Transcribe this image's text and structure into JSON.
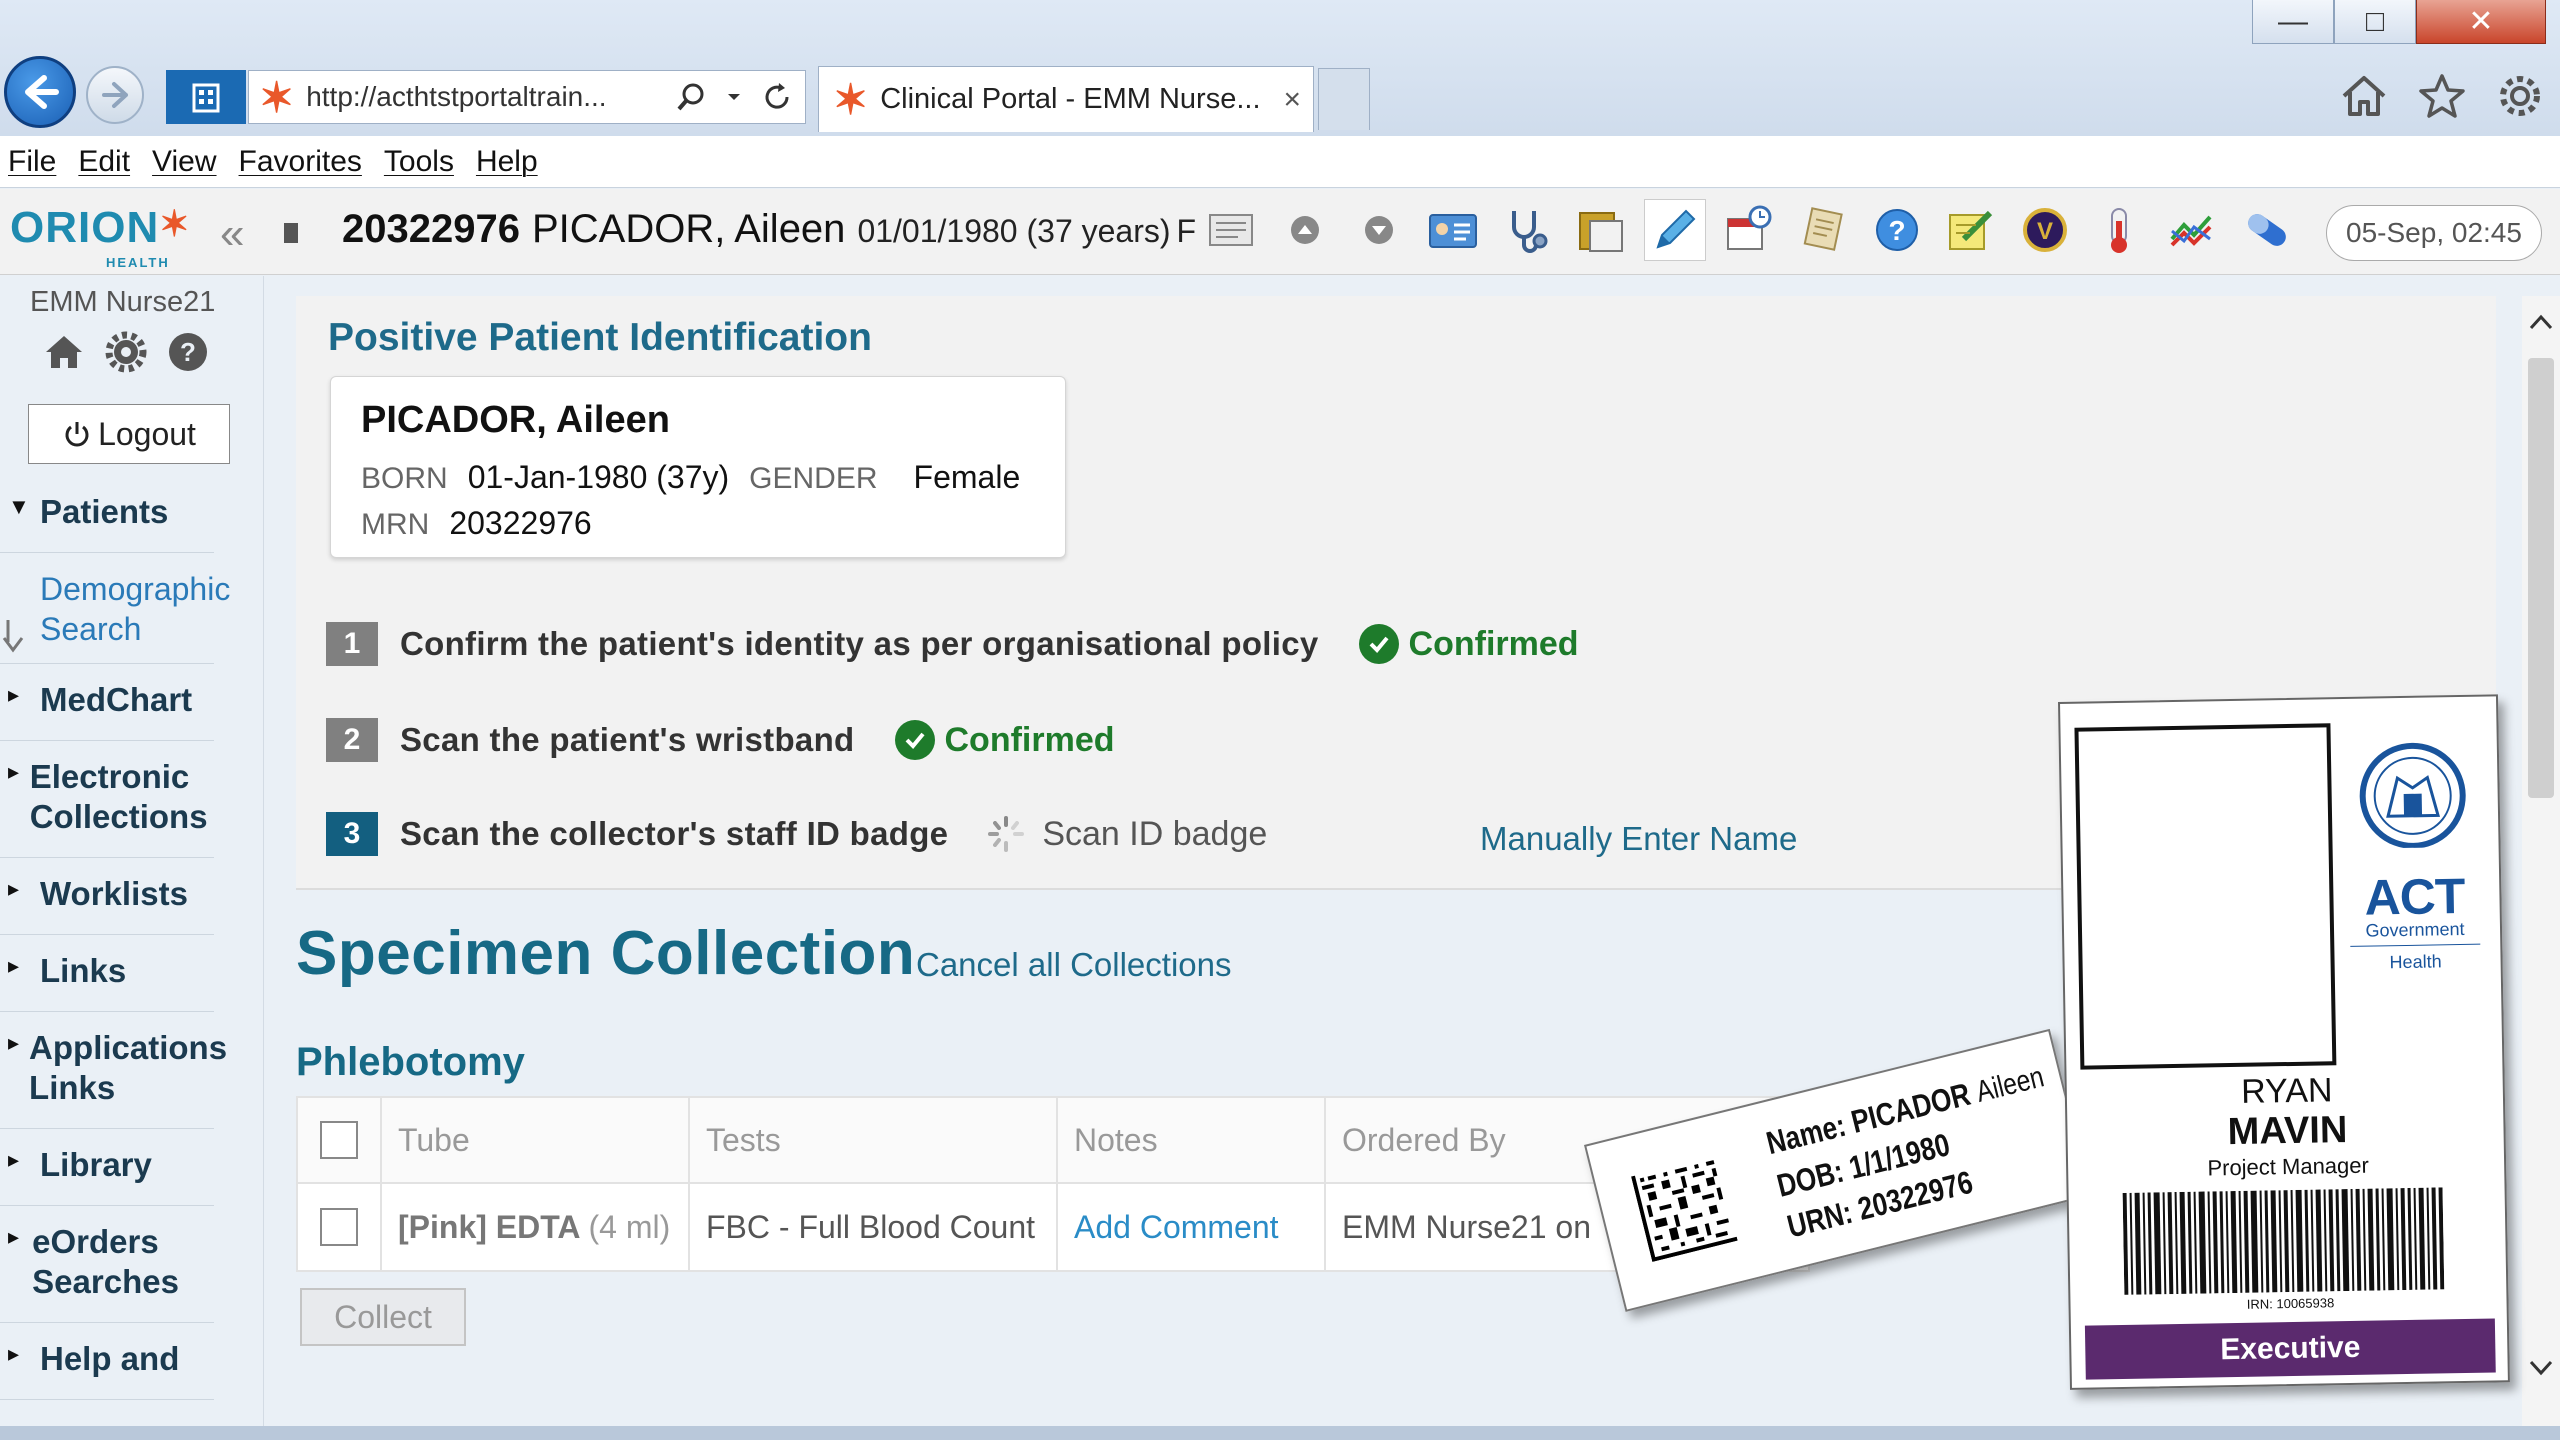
{
  "window": {
    "minimize": "—",
    "maximize": "□",
    "close": "✕"
  },
  "browser": {
    "address": "http://acthtstportaltrain...",
    "tab_title": "Clinical Portal - EMM Nurse...",
    "tab_close": "×",
    "menu": [
      "File",
      "Edit",
      "View",
      "Favorites",
      "Tools",
      "Help"
    ]
  },
  "header": {
    "logo": "ORION",
    "logo_sub": "HEALTH",
    "collapse": "«",
    "patient_mrn": "20322976",
    "patient_name": "PICADOR, Aileen",
    "patient_dob": "01/01/1980 (37 years)",
    "patient_sex": "F",
    "date": "05-Sep, 02:45",
    "toolbar_icons": [
      "notes-icon",
      "up-icon",
      "down-icon",
      "id-card-icon",
      "stethoscope-icon",
      "folder-icon",
      "pen-icon",
      "calendar-icon",
      "scroll-icon",
      "help-icon",
      "edit-icon",
      "badge-icon",
      "thermometer-icon",
      "chart-icon",
      "pill-icon"
    ]
  },
  "sidebar": {
    "user": "EMM Nurse21",
    "logout": "Logout",
    "nav": [
      {
        "label": "Patients",
        "expanded": true
      },
      {
        "label": "Demographic Search",
        "sub": true
      },
      {
        "label": "MedChart"
      },
      {
        "label": "Electronic Collections"
      },
      {
        "label": "Worklists"
      },
      {
        "label": "Links"
      },
      {
        "label": "Applications Links"
      },
      {
        "label": "Library"
      },
      {
        "label": "eOrders Searches"
      },
      {
        "label": "Help and"
      }
    ]
  },
  "ppi": {
    "title": "Positive Patient Identification",
    "card": {
      "name": "PICADOR, Aileen",
      "born_label": "BORN",
      "born": "01-Jan-1980 (37y)",
      "gender_label": "GENDER",
      "gender": "Female",
      "mrn_label": "MRN",
      "mrn": "20322976"
    },
    "steps": [
      {
        "num": "1",
        "text": "Confirm the patient's identity as per organisational policy",
        "status": "Confirmed"
      },
      {
        "num": "2",
        "text": "Scan the patient's wristband",
        "status": "Confirmed"
      },
      {
        "num": "3",
        "text": "Scan the collector's staff ID badge",
        "status": "Scan ID badge"
      }
    ],
    "manual_link": "Manually Enter Name"
  },
  "specimen": {
    "title": "Specimen Collection",
    "cancel_link": "Cancel all Collections",
    "section": "Phlebotomy",
    "columns": [
      "Tube",
      "Tests",
      "Notes",
      "Ordered By"
    ],
    "rows": [
      {
        "tube": "[Pink] EDTA",
        "volume": "(4 ml)",
        "tests": "FBC - Full Blood Count",
        "notes": "Add Comment",
        "ordered_by": "EMM Nurse21 on"
      }
    ],
    "collect_button": "Collect"
  },
  "wristband": {
    "name_label": "Name:",
    "surname": "PICADOR",
    "given": "Aileen",
    "dob_label": "DOB:",
    "dob": "1/1/1980",
    "urn_label": "URN:",
    "urn": "20322976"
  },
  "badge": {
    "org": "ACT",
    "org_sub": "Government",
    "dept": "Health",
    "first_name": "RYAN",
    "last_name": "MAVIN",
    "role": "Project Manager",
    "irn": "IRN: 10065938",
    "band": "Executive",
    "band_color": "#5b2a6e"
  },
  "colors": {
    "accent": "#166985",
    "confirmed": "#1e7b2b",
    "link": "#2a8cc7"
  }
}
